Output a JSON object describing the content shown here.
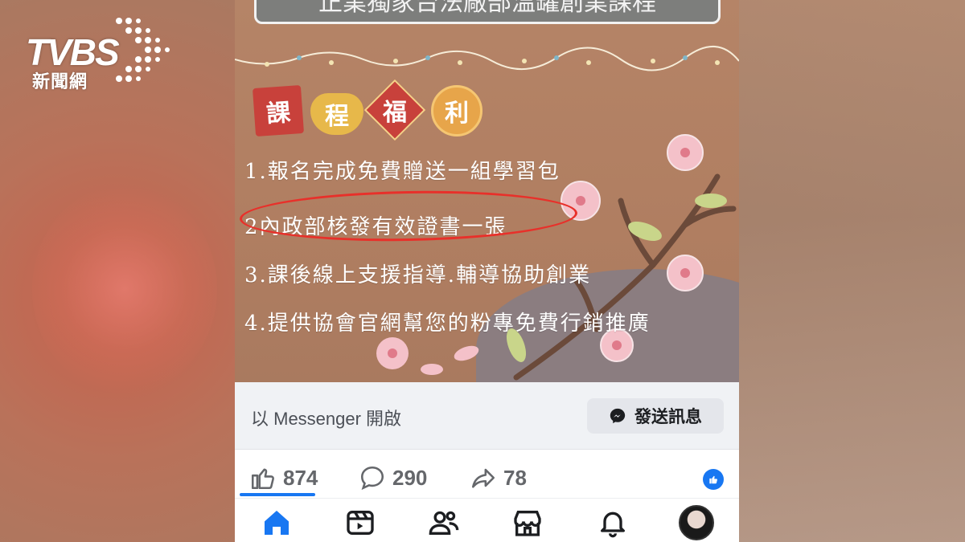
{
  "watermark": {
    "brand": "TVBS",
    "subtitle": "新聞網"
  },
  "post_image": {
    "banner_text": "正業獨家台法廠部溫罐創業課程",
    "badges": [
      "課",
      "程",
      "福",
      "利"
    ],
    "benefits": [
      "1.報名完成免費贈送一組學習包",
      "2內政部核發有效證書一張",
      "3.課後線上支援指導.輔導協助創業",
      "4.提供協會官網幫您的粉專免費行銷推廣"
    ]
  },
  "messenger": {
    "label": "以 Messenger 開啟",
    "button_label": "發送訊息"
  },
  "reactions": {
    "likes": "874",
    "comments": "290",
    "shares": "78"
  },
  "nav": {
    "items": [
      "home-icon",
      "video-icon",
      "friends-icon",
      "marketplace-icon",
      "bell-icon",
      "avatar"
    ]
  },
  "colors": {
    "facebook_blue": "#1877f2",
    "post_bg": "#b58467",
    "highlight_circle": "#e8302a"
  }
}
